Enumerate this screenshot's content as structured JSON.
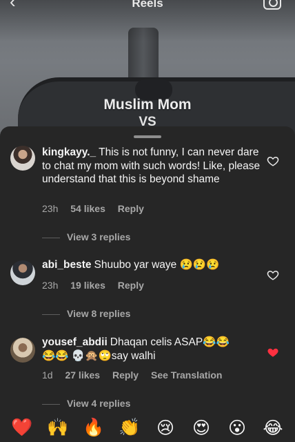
{
  "header": {
    "title": "Reels",
    "back_icon": "chevron-left-icon",
    "camera_icon": "camera-icon"
  },
  "video": {
    "overlay_line1": "Muslim Mom",
    "overlay_line2": "VS"
  },
  "comments": [
    {
      "username": "kingkayy._",
      "text": "This is not funny, I can never dare to chat my mom with such words! Like, please understand that this is beyond shame",
      "time": "23h",
      "likes": "54 likes",
      "reply": "Reply",
      "view_replies": "View 3 replies",
      "liked": false
    },
    {
      "username": "abi_beste",
      "text": "Shuubo yar waye 😢😢😢",
      "time": "23h",
      "likes": "19 likes",
      "reply": "Reply",
      "view_replies": "View 8 replies",
      "liked": false
    },
    {
      "username": "yousef_abdii",
      "text": "Dhaqan celis ASAP😂😂",
      "text_line2": "😂😂 💀🙊🙄say walhi",
      "time": "1d",
      "likes": "27 likes",
      "reply": "Reply",
      "see_translation": "See Translation",
      "view_replies": "View 4 replies",
      "liked": true
    }
  ],
  "emoji_bar": [
    "❤️",
    "🙌",
    "🔥",
    "👏",
    "😢",
    "😍",
    "😮",
    "😂"
  ],
  "colors": {
    "sheet_bg": "#262626",
    "text_primary": "#f5f5f5",
    "text_secondary": "#a8a8a8",
    "like_red": "#ff3040"
  }
}
